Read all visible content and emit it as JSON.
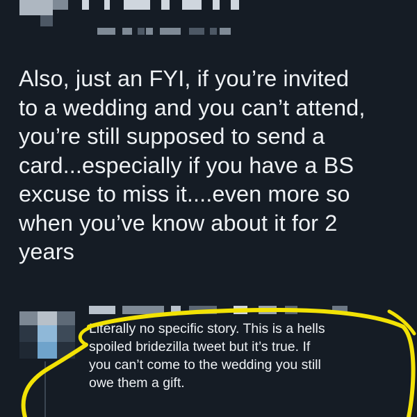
{
  "post": {
    "text": "Also, just an FYI, if you’re invited\nto a wedding and you can’t attend,\nyou’re still supposed to send a\ncard...especially if you have a BS\nexcuse to miss it....even more so\nwhen you’ve know about it for 2\nyears"
  },
  "reply": {
    "text": "Literally no specific story. This is a hells\nspoiled bridezilla tweet but it’s true. If\nyou can’t come to the wedding you still\nowe them a gift."
  },
  "colors": {
    "background": "#151c25",
    "text": "#eef1f4",
    "highlight": "#f2e205"
  }
}
